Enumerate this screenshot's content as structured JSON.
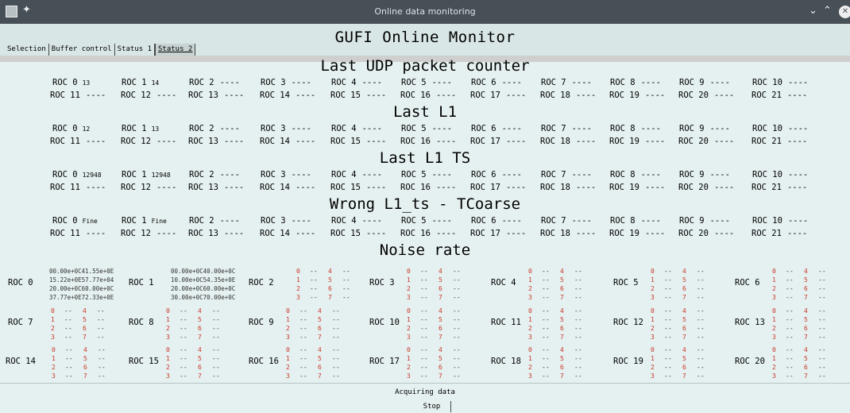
{
  "window": {
    "title": "Online data monitoring"
  },
  "app": {
    "heading": "GUFI Online Monitor"
  },
  "tabs": [
    {
      "label": "Selection",
      "active": false
    },
    {
      "label": "Buffer control",
      "active": false
    },
    {
      "label": "Status 1",
      "active": false
    },
    {
      "label": "Status 2",
      "active": true
    }
  ],
  "sections": [
    {
      "title": "Last UDP packet counter",
      "rows": [
        [
          {
            "roc": "ROC 0",
            "val": "13"
          },
          {
            "roc": "ROC 1",
            "val": "14"
          },
          {
            "roc": "ROC 2",
            "val": "----"
          },
          {
            "roc": "ROC 3",
            "val": "----"
          },
          {
            "roc": "ROC 4",
            "val": "----"
          },
          {
            "roc": "ROC 5",
            "val": "----"
          },
          {
            "roc": "ROC 6",
            "val": "----"
          },
          {
            "roc": "ROC 7",
            "val": "----"
          },
          {
            "roc": "ROC 8",
            "val": "----"
          },
          {
            "roc": "ROC 9",
            "val": "----"
          },
          {
            "roc": "ROC 10",
            "val": "----"
          }
        ],
        [
          {
            "roc": "ROC 11",
            "val": "----"
          },
          {
            "roc": "ROC 12",
            "val": "----"
          },
          {
            "roc": "ROC 13",
            "val": "----"
          },
          {
            "roc": "ROC 14",
            "val": "----"
          },
          {
            "roc": "ROC 15",
            "val": "----"
          },
          {
            "roc": "ROC 16",
            "val": "----"
          },
          {
            "roc": "ROC 17",
            "val": "----"
          },
          {
            "roc": "ROC 18",
            "val": "----"
          },
          {
            "roc": "ROC 19",
            "val": "----"
          },
          {
            "roc": "ROC 20",
            "val": "----"
          },
          {
            "roc": "ROC 21",
            "val": "----"
          }
        ]
      ]
    },
    {
      "title": "Last L1",
      "rows": [
        [
          {
            "roc": "ROC 0",
            "val": "12"
          },
          {
            "roc": "ROC 1",
            "val": "13"
          },
          {
            "roc": "ROC 2",
            "val": "----"
          },
          {
            "roc": "ROC 3",
            "val": "----"
          },
          {
            "roc": "ROC 4",
            "val": "----"
          },
          {
            "roc": "ROC 5",
            "val": "----"
          },
          {
            "roc": "ROC 6",
            "val": "----"
          },
          {
            "roc": "ROC 7",
            "val": "----"
          },
          {
            "roc": "ROC 8",
            "val": "----"
          },
          {
            "roc": "ROC 9",
            "val": "----"
          },
          {
            "roc": "ROC 10",
            "val": "----"
          }
        ],
        [
          {
            "roc": "ROC 11",
            "val": "----"
          },
          {
            "roc": "ROC 12",
            "val": "----"
          },
          {
            "roc": "ROC 13",
            "val": "----"
          },
          {
            "roc": "ROC 14",
            "val": "----"
          },
          {
            "roc": "ROC 15",
            "val": "----"
          },
          {
            "roc": "ROC 16",
            "val": "----"
          },
          {
            "roc": "ROC 17",
            "val": "----"
          },
          {
            "roc": "ROC 18",
            "val": "----"
          },
          {
            "roc": "ROC 19",
            "val": "----"
          },
          {
            "roc": "ROC 20",
            "val": "----"
          },
          {
            "roc": "ROC 21",
            "val": "----"
          }
        ]
      ]
    },
    {
      "title": "Last L1 TS",
      "rows": [
        [
          {
            "roc": "ROC 0",
            "val": "12948"
          },
          {
            "roc": "ROC 1",
            "val": "12948"
          },
          {
            "roc": "ROC 2",
            "val": "----"
          },
          {
            "roc": "ROC 3",
            "val": "----"
          },
          {
            "roc": "ROC 4",
            "val": "----"
          },
          {
            "roc": "ROC 5",
            "val": "----"
          },
          {
            "roc": "ROC 6",
            "val": "----"
          },
          {
            "roc": "ROC 7",
            "val": "----"
          },
          {
            "roc": "ROC 8",
            "val": "----"
          },
          {
            "roc": "ROC 9",
            "val": "----"
          },
          {
            "roc": "ROC 10",
            "val": "----"
          }
        ],
        [
          {
            "roc": "ROC 11",
            "val": "----"
          },
          {
            "roc": "ROC 12",
            "val": "----"
          },
          {
            "roc": "ROC 13",
            "val": "----"
          },
          {
            "roc": "ROC 14",
            "val": "----"
          },
          {
            "roc": "ROC 15",
            "val": "----"
          },
          {
            "roc": "ROC 16",
            "val": "----"
          },
          {
            "roc": "ROC 17",
            "val": "----"
          },
          {
            "roc": "ROC 18",
            "val": "----"
          },
          {
            "roc": "ROC 19",
            "val": "----"
          },
          {
            "roc": "ROC 20",
            "val": "----"
          },
          {
            "roc": "ROC 21",
            "val": "----"
          }
        ]
      ]
    },
    {
      "title": "Wrong L1_ts - TCoarse",
      "rows": [
        [
          {
            "roc": "ROC 0",
            "val": "Fine"
          },
          {
            "roc": "ROC 1",
            "val": "Fine"
          },
          {
            "roc": "ROC 2",
            "val": "----"
          },
          {
            "roc": "ROC 3",
            "val": "----"
          },
          {
            "roc": "ROC 4",
            "val": "----"
          },
          {
            "roc": "ROC 5",
            "val": "----"
          },
          {
            "roc": "ROC 6",
            "val": "----"
          },
          {
            "roc": "ROC 7",
            "val": "----"
          },
          {
            "roc": "ROC 8",
            "val": "----"
          },
          {
            "roc": "ROC 9",
            "val": "----"
          },
          {
            "roc": "ROC 10",
            "val": "----"
          }
        ],
        [
          {
            "roc": "ROC 11",
            "val": "----"
          },
          {
            "roc": "ROC 12",
            "val": "----"
          },
          {
            "roc": "ROC 13",
            "val": "----"
          },
          {
            "roc": "ROC 14",
            "val": "----"
          },
          {
            "roc": "ROC 15",
            "val": "----"
          },
          {
            "roc": "ROC 16",
            "val": "----"
          },
          {
            "roc": "ROC 17",
            "val": "----"
          },
          {
            "roc": "ROC 18",
            "val": "----"
          },
          {
            "roc": "ROC 19",
            "val": "----"
          },
          {
            "roc": "ROC 20",
            "val": "----"
          },
          {
            "roc": "ROC 21",
            "val": "----"
          }
        ]
      ]
    }
  ],
  "noise": {
    "title": "Noise rate",
    "roc0_lines": [
      "00.00e+0C41.55e+0E",
      "15.22e+0E57.77e+04",
      "20.00e+0C60.00e+0C",
      "37.77e+0E72.33e+0E"
    ],
    "roc1_lines": [
      "00.00e+0C40.00e+0C",
      "10.00e+0C54.35e+0E",
      "20.00e+0C60.00e+0C",
      "30.00e+0C70.00e+0C"
    ],
    "rows": [
      [
        "ROC 0",
        "ROC 1",
        "ROC 2",
        "ROC 3",
        "ROC 4",
        "ROC 5",
        "ROC 6"
      ],
      [
        "ROC 7",
        "ROC 8",
        "ROC 9",
        "ROC 10",
        "ROC 11",
        "ROC 12",
        "ROC 13"
      ],
      [
        "ROC 14",
        "ROC 15",
        "ROC 16",
        "ROC 17",
        "ROC 18",
        "ROC 19",
        "ROC 20"
      ]
    ],
    "channels_left": [
      "0",
      "1",
      "2",
      "3"
    ],
    "channels_right": [
      "4",
      "5",
      "6",
      "7"
    ],
    "empty_value": "--"
  },
  "footer": {
    "status": "Acquiring data",
    "stop_label": "Stop"
  },
  "icons": {
    "app": "app-icon",
    "pin": "pin-icon",
    "minimize": "minimize-icon",
    "maximize": "maximize-icon",
    "close": "close-icon"
  }
}
